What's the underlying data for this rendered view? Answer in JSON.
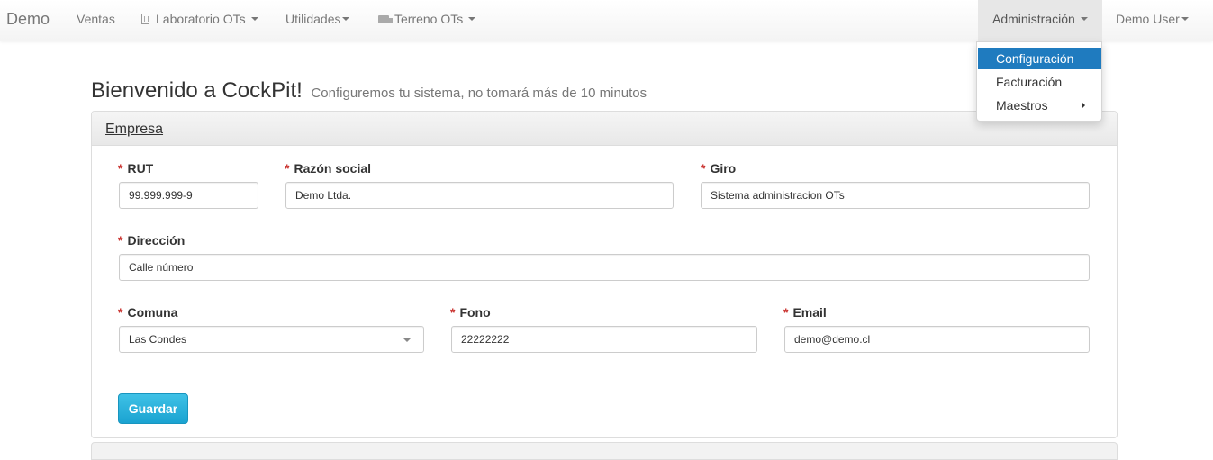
{
  "navbar": {
    "brand": "Demo",
    "items": [
      {
        "label": "Ventas"
      },
      {
        "label": "Laboratorio OTs",
        "icon": "building-icon"
      },
      {
        "label": "Utilidades"
      },
      {
        "label": "Terreno OTs",
        "icon": "truck-icon"
      }
    ],
    "admin_label": "Administración",
    "user_label": "Demo User"
  },
  "admin_menu": {
    "items": [
      {
        "label": "Configuración",
        "active": true
      },
      {
        "label": "Facturación"
      },
      {
        "label": "Maestros",
        "has_submenu": true
      }
    ],
    "active_color": "#1f7bbf"
  },
  "page": {
    "title": "Bienvenido a CockPit!",
    "subtitle": "Configuremos tu sistema, no tomará más de 10 minutos"
  },
  "form": {
    "panel_title": "Empresa",
    "required_mark": "*",
    "fields": {
      "rut": {
        "label": "RUT",
        "value": "99.999.999-9"
      },
      "razon_social": {
        "label": "Razón social",
        "value": "Demo Ltda."
      },
      "giro": {
        "label": "Giro",
        "value": "Sistema administracion OTs"
      },
      "direccion": {
        "label": "Dirección",
        "value": "Calle número"
      },
      "comuna": {
        "label": "Comuna",
        "value": "Las Condes"
      },
      "fono": {
        "label": "Fono",
        "value": "22222222"
      },
      "email": {
        "label": "Email",
        "value": "demo@demo.cl"
      }
    },
    "save_label": "Guardar",
    "save_color": "#1aa3d1"
  }
}
